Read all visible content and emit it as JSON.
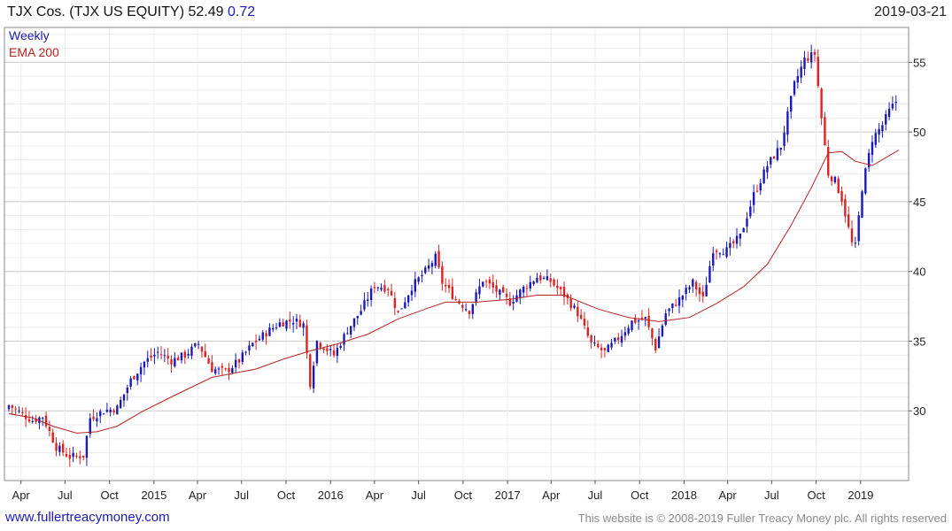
{
  "header": {
    "name": "TJX Cos. (TJX US EQUITY)",
    "last": "52.49",
    "change": "0.72",
    "date": "2019-03-21"
  },
  "footer": {
    "site": "www.fullertreacymoney.com",
    "copyright": "This website is © 2008-2019 Fuller Treacy Money plc. All rights reserved"
  },
  "colors": {
    "up": "#1a1ab8",
    "down": "#dd2222",
    "ema": "#b52222",
    "grid_major": "#c8c8c8",
    "grid_minor": "#ececec"
  },
  "chart_data": {
    "type": "candlestick",
    "frequency": "Weekly",
    "legend": [
      "Weekly",
      "EMA 200"
    ],
    "legend_position": "top-left",
    "ylim": [
      25,
      57.5
    ],
    "y_ticks": [
      30,
      35,
      40,
      45,
      50,
      55
    ],
    "y_axis_side": "right",
    "grid": true,
    "x_ticks": [
      {
        "label": "Apr",
        "date": "2014-04-01"
      },
      {
        "label": "Jul",
        "date": "2014-07-01"
      },
      {
        "label": "Oct",
        "date": "2014-10-01"
      },
      {
        "label": "2015",
        "date": "2015-01-01"
      },
      {
        "label": "Apr",
        "date": "2015-04-01"
      },
      {
        "label": "Jul",
        "date": "2015-07-01"
      },
      {
        "label": "Oct",
        "date": "2015-10-01"
      },
      {
        "label": "2016",
        "date": "2016-01-01"
      },
      {
        "label": "Apr",
        "date": "2016-04-01"
      },
      {
        "label": "Jul",
        "date": "2016-07-01"
      },
      {
        "label": "Oct",
        "date": "2016-10-01"
      },
      {
        "label": "2017",
        "date": "2017-01-01"
      },
      {
        "label": "Apr",
        "date": "2017-04-01"
      },
      {
        "label": "Jul",
        "date": "2017-07-01"
      },
      {
        "label": "Oct",
        "date": "2017-10-01"
      },
      {
        "label": "2018",
        "date": "2018-01-01"
      },
      {
        "label": "Apr",
        "date": "2018-04-01"
      },
      {
        "label": "Jul",
        "date": "2018-07-01"
      },
      {
        "label": "Oct",
        "date": "2018-10-01"
      },
      {
        "label": "2019",
        "date": "2019-01-01"
      }
    ],
    "close_path": [
      [
        "2014-03-07",
        30.4
      ],
      [
        "2014-04-25",
        29.3
      ],
      [
        "2014-05-16",
        29.6
      ],
      [
        "2014-06-13",
        27.4
      ],
      [
        "2014-07-11",
        26.7
      ],
      [
        "2014-08-08",
        26.8
      ],
      [
        "2014-08-22",
        29.5
      ],
      [
        "2014-09-19",
        30.0
      ],
      [
        "2014-10-17",
        30.2
      ],
      [
        "2014-11-14",
        32.2
      ],
      [
        "2014-12-12",
        33.5
      ],
      [
        "2015-01-09",
        34.2
      ],
      [
        "2015-02-06",
        33.6
      ],
      [
        "2015-03-06",
        34.0
      ],
      [
        "2015-04-03",
        34.8
      ],
      [
        "2015-05-01",
        33.0
      ],
      [
        "2015-05-29",
        32.8
      ],
      [
        "2015-06-26",
        33.6
      ],
      [
        "2015-07-24",
        34.8
      ],
      [
        "2015-08-21",
        35.6
      ],
      [
        "2015-09-18",
        36.3
      ],
      [
        "2015-10-16",
        36.5
      ],
      [
        "2015-11-06",
        36.2
      ],
      [
        "2015-11-20",
        32.0
      ],
      [
        "2015-12-04",
        35.0
      ],
      [
        "2016-01-08",
        34.0
      ],
      [
        "2016-02-05",
        35.8
      ],
      [
        "2016-03-04",
        37.2
      ],
      [
        "2016-04-01",
        39.0
      ],
      [
        "2016-04-29",
        38.8
      ],
      [
        "2016-05-20",
        37.0
      ],
      [
        "2016-06-17",
        38.9
      ],
      [
        "2016-07-15",
        40.0
      ],
      [
        "2016-08-05",
        41.0
      ],
      [
        "2016-08-19",
        39.2
      ],
      [
        "2016-09-16",
        38.0
      ],
      [
        "2016-10-14",
        37.2
      ],
      [
        "2016-11-11",
        39.4
      ],
      [
        "2016-12-09",
        38.6
      ],
      [
        "2017-01-06",
        37.8
      ],
      [
        "2017-02-03",
        38.8
      ],
      [
        "2017-03-03",
        39.6
      ],
      [
        "2017-03-31",
        39.3
      ],
      [
        "2017-04-28",
        38.3
      ],
      [
        "2017-05-26",
        37.0
      ],
      [
        "2017-06-23",
        34.8
      ],
      [
        "2017-07-21",
        34.2
      ],
      [
        "2017-08-18",
        35.2
      ],
      [
        "2017-09-15",
        36.4
      ],
      [
        "2017-10-13",
        36.6
      ],
      [
        "2017-11-03",
        34.5
      ],
      [
        "2017-11-24",
        37.0
      ],
      [
        "2017-12-22",
        38.0
      ],
      [
        "2018-01-19",
        39.2
      ],
      [
        "2018-02-09",
        38.0
      ],
      [
        "2018-03-02",
        41.6
      ],
      [
        "2018-03-30",
        41.5
      ],
      [
        "2018-04-27",
        42.5
      ],
      [
        "2018-05-25",
        45.5
      ],
      [
        "2018-06-22",
        47.6
      ],
      [
        "2018-07-20",
        49.0
      ],
      [
        "2018-08-17",
        53.4
      ],
      [
        "2018-09-07",
        55.2
      ],
      [
        "2018-09-28",
        55.6
      ],
      [
        "2018-10-12",
        51.0
      ],
      [
        "2018-10-26",
        47.0
      ],
      [
        "2018-11-09",
        46.5
      ],
      [
        "2018-11-23",
        45.2
      ],
      [
        "2018-12-14",
        42.0
      ],
      [
        "2018-12-21",
        41.8
      ],
      [
        "2019-01-04",
        46.0
      ],
      [
        "2019-01-25",
        49.5
      ],
      [
        "2019-02-15",
        50.5
      ],
      [
        "2019-03-01",
        51.5
      ],
      [
        "2019-03-21",
        52.49
      ]
    ],
    "ema_200": [
      [
        "2014-03-07",
        29.8
      ],
      [
        "2014-04-25",
        29.5
      ],
      [
        "2014-06-06",
        28.9
      ],
      [
        "2014-07-25",
        28.4
      ],
      [
        "2014-09-05",
        28.5
      ],
      [
        "2014-10-17",
        28.9
      ],
      [
        "2014-12-05",
        29.9
      ],
      [
        "2015-02-06",
        31.0
      ],
      [
        "2015-05-01",
        32.4
      ],
      [
        "2015-07-31",
        33.0
      ],
      [
        "2015-09-25",
        33.7
      ],
      [
        "2015-11-20",
        34.3
      ],
      [
        "2016-01-15",
        34.8
      ],
      [
        "2016-03-18",
        35.5
      ],
      [
        "2016-05-20",
        36.6
      ],
      [
        "2016-07-15",
        37.3
      ],
      [
        "2016-08-26",
        37.8
      ],
      [
        "2016-10-28",
        37.8
      ],
      [
        "2017-01-06",
        38.0
      ],
      [
        "2017-03-03",
        38.3
      ],
      [
        "2017-04-28",
        38.3
      ],
      [
        "2017-07-07",
        37.3
      ],
      [
        "2017-09-08",
        36.7
      ],
      [
        "2017-11-10",
        36.4
      ],
      [
        "2018-01-12",
        36.7
      ],
      [
        "2018-03-09",
        37.7
      ],
      [
        "2018-05-04",
        38.9
      ],
      [
        "2018-06-22",
        40.5
      ],
      [
        "2018-08-10",
        43.3
      ],
      [
        "2018-09-21",
        46.0
      ],
      [
        "2018-10-26",
        48.5
      ],
      [
        "2018-11-23",
        48.6
      ],
      [
        "2018-12-21",
        47.9
      ],
      [
        "2019-01-25",
        47.6
      ],
      [
        "2019-03-21",
        48.7
      ]
    ]
  }
}
